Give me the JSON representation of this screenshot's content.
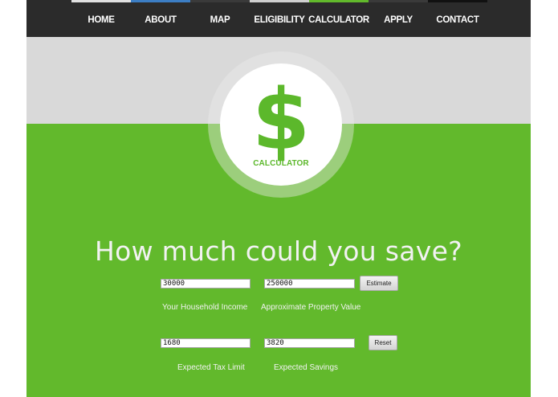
{
  "nav": {
    "items": [
      {
        "label": "HOME",
        "accent": "#e0e0e0"
      },
      {
        "label": "ABOUT",
        "accent": "#3c7ec4"
      },
      {
        "label": "MAP",
        "accent": "#3a3a3a"
      },
      {
        "label": "ELIGIBILITY",
        "accent": "#cfcfcf"
      },
      {
        "label": "CALCULATOR",
        "accent": "#62b92c"
      },
      {
        "label": "APPLY",
        "accent": "#3a3a3a"
      },
      {
        "label": "CONTACT",
        "accent": "#111111"
      }
    ]
  },
  "hero": {
    "icon": "dollar-icon",
    "icon_glyph": "$",
    "label": "CALCULATOR"
  },
  "calculator": {
    "heading": "How much could you save?",
    "household_income": {
      "value": "30000",
      "label": "Your Household Income"
    },
    "property_value": {
      "value": "250000",
      "label": "Approximate Property Value"
    },
    "estimate_button": "Estimate",
    "tax_limit": {
      "value": "1680",
      "label": "Expected Tax Limit"
    },
    "savings": {
      "value": "3820",
      "label": "Expected Savings"
    },
    "reset_button": "Reset"
  },
  "colors": {
    "nav_bg": "#2b2b2b",
    "accent_green": "#62b92c",
    "hero_gray": "#d9d9d9"
  }
}
